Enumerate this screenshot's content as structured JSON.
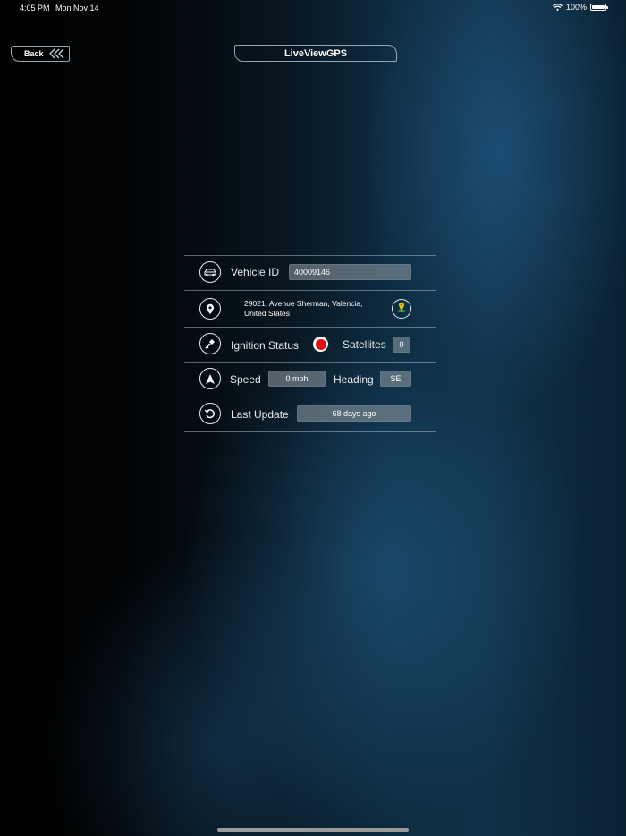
{
  "status_bar": {
    "time": "4:05 PM",
    "date": "Mon Nov 14",
    "battery": "100%"
  },
  "nav": {
    "back_label": "Back",
    "title": "LiveViewGPS"
  },
  "vehicle": {
    "id_label": "Vehicle ID",
    "id_value": "40009146",
    "address_line1": "29021, Avenue Sherman, Valencia,",
    "address_line2": "United States",
    "ignition_label": "Ignition Status",
    "ignition_color": "#e01010",
    "satellites_label": "Satellites",
    "satellites_value": "0",
    "speed_label": "Speed",
    "speed_value": "0 mph",
    "heading_label": "Heading",
    "heading_value": "SE",
    "last_update_label": "Last Update",
    "last_update_value": "68 days ago"
  },
  "icons": {
    "vehicle": "car-icon",
    "location": "location-pin-icon",
    "map": "map-pin-icon",
    "ignition": "key-icon",
    "speed": "navigation-arrow-icon",
    "last_update": "refresh-icon"
  }
}
